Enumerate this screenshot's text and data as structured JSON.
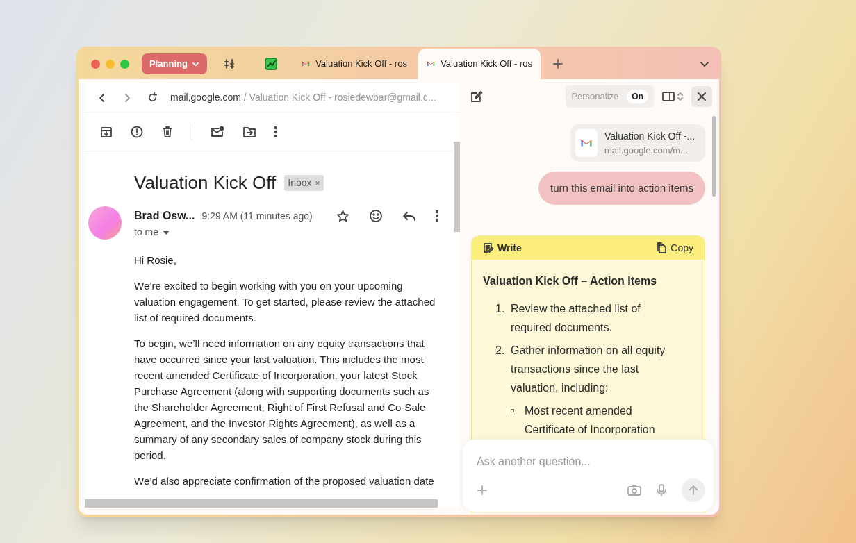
{
  "tabs": [
    {
      "kind": "group",
      "label": "Planning",
      "selected": false
    },
    {
      "kind": "tools",
      "selected": false
    },
    {
      "kind": "chart",
      "selected": false
    },
    {
      "kind": "page",
      "label": "Valuation Kick Off - ros",
      "selected": false
    },
    {
      "kind": "page",
      "label": "Valuation Kick Off - ros",
      "selected": true
    }
  ],
  "address_bar": {
    "domain": "mail.google.com",
    "path": "/ Valuation Kick Off - rosiedewbar@gmail.c..."
  },
  "email": {
    "subject": "Valuation Kick Off",
    "label": "Inbox",
    "label_close": "×",
    "sender": "Brad Osw...",
    "time": "9:29 AM (11 minutes ago)",
    "recipient": "to me",
    "paragraphs": [
      "Hi Rosie,",
      "We’re excited to begin working with you on your upcoming valuation engagement. To get started, please review the attached list of required documents.",
      "To begin, we’ll need information on any equity transactions that have occurred since your last valuation. This includes the most recent amended Certificate of Incorporation, your latest Stock Purchase Agreement (along with supporting documents such as the Shareholder Agreement, Right of First Refusal and Co-Sale Agreement, and the Investor Rights Agreement), as well as a summary of any secondary sales of company stock during this period.",
      "We’d also appreciate confirmation of the proposed valuation date"
    ]
  },
  "assistant": {
    "personalize": {
      "label": "Personalize",
      "toggle": "On",
      "on": true
    },
    "attachment": {
      "title": "Valuation Kick Off -...",
      "url": "mail.google.com/m..."
    },
    "user_message": "turn this email into action items",
    "response": {
      "write_label": "Write",
      "copy_label": "Copy",
      "heading": "Valuation Kick Off – Action Items",
      "items": [
        {
          "number": "1.",
          "text": "Review the attached list of required documents."
        },
        {
          "number": "2.",
          "text": "Gather information on all equity transactions since the last valuation, including:",
          "children": [
            "Most recent amended Certificate of Incorporation"
          ]
        }
      ]
    },
    "input": {
      "placeholder": "Ask another question..."
    }
  }
}
